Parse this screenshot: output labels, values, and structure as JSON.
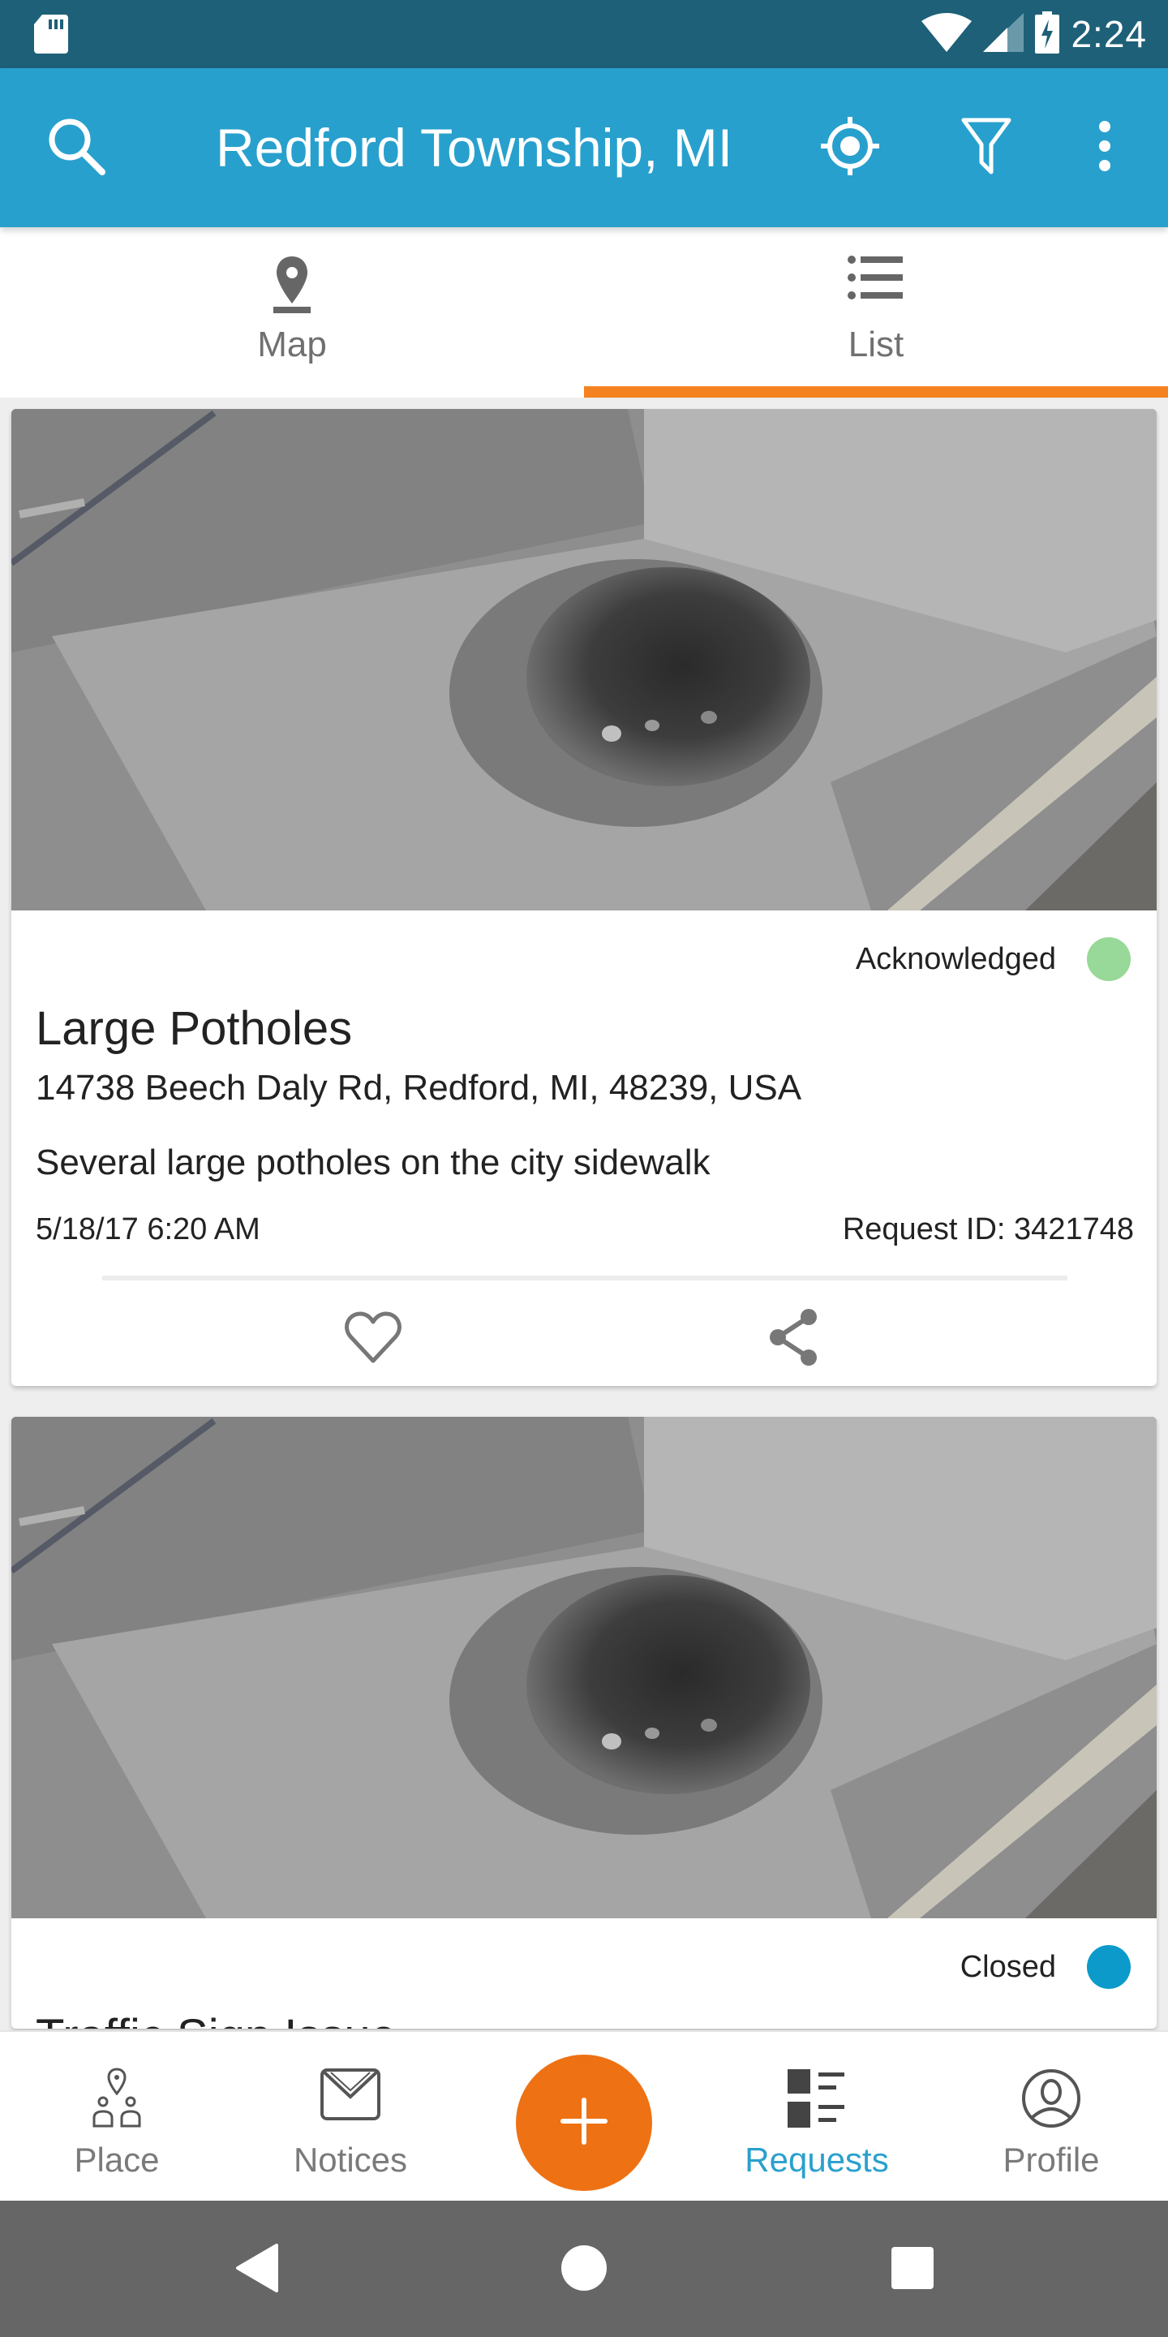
{
  "status_bar": {
    "time": "2:24",
    "icons": [
      "sd-card-icon",
      "wifi-icon",
      "cell-signal-icon",
      "battery-charging-icon"
    ]
  },
  "app_bar": {
    "title": "Redford Township, MI",
    "icons": [
      "search-icon",
      "my-location-icon",
      "filter-icon",
      "more-vert-icon"
    ]
  },
  "tabs": [
    {
      "label": "Map",
      "icon": "map-pin-icon",
      "active": false
    },
    {
      "label": "List",
      "icon": "list-icon",
      "active": true
    }
  ],
  "colors": {
    "status_bar": "#1e6078",
    "app_bar": "#28a0cd",
    "tab_indicator": "#f58220",
    "fab": "#ee7113",
    "active_nav": "#2aa0cd",
    "status_acknowledged": "#98d898",
    "status_closed": "#0c9acb"
  },
  "requests": [
    {
      "status": "Acknowledged",
      "status_color": "#98d898",
      "title": "Large Potholes",
      "address": "14738 Beech Daly Rd, Redford, MI, 48239, USA",
      "description": "Several large potholes on the city sidewalk",
      "date": "5/18/17 6:20 AM",
      "request_id": "Request ID: 3421748",
      "image_alt": "pothole-photo"
    },
    {
      "status": "Closed",
      "status_color": "#0c9acb",
      "title": "Traffic Sign Issue",
      "image_alt": "pothole-photo"
    }
  ],
  "bottom_nav": {
    "items": [
      {
        "label": "Place",
        "icon": "place-people-icon",
        "active": false
      },
      {
        "label": "Notices",
        "icon": "envelope-icon",
        "active": false
      },
      {
        "label": "Requests",
        "icon": "requests-list-icon",
        "active": true
      },
      {
        "label": "Profile",
        "icon": "profile-icon",
        "active": false
      }
    ],
    "fab_icon": "plus-icon"
  },
  "system_nav": [
    "back-icon",
    "home-icon",
    "recents-icon"
  ]
}
